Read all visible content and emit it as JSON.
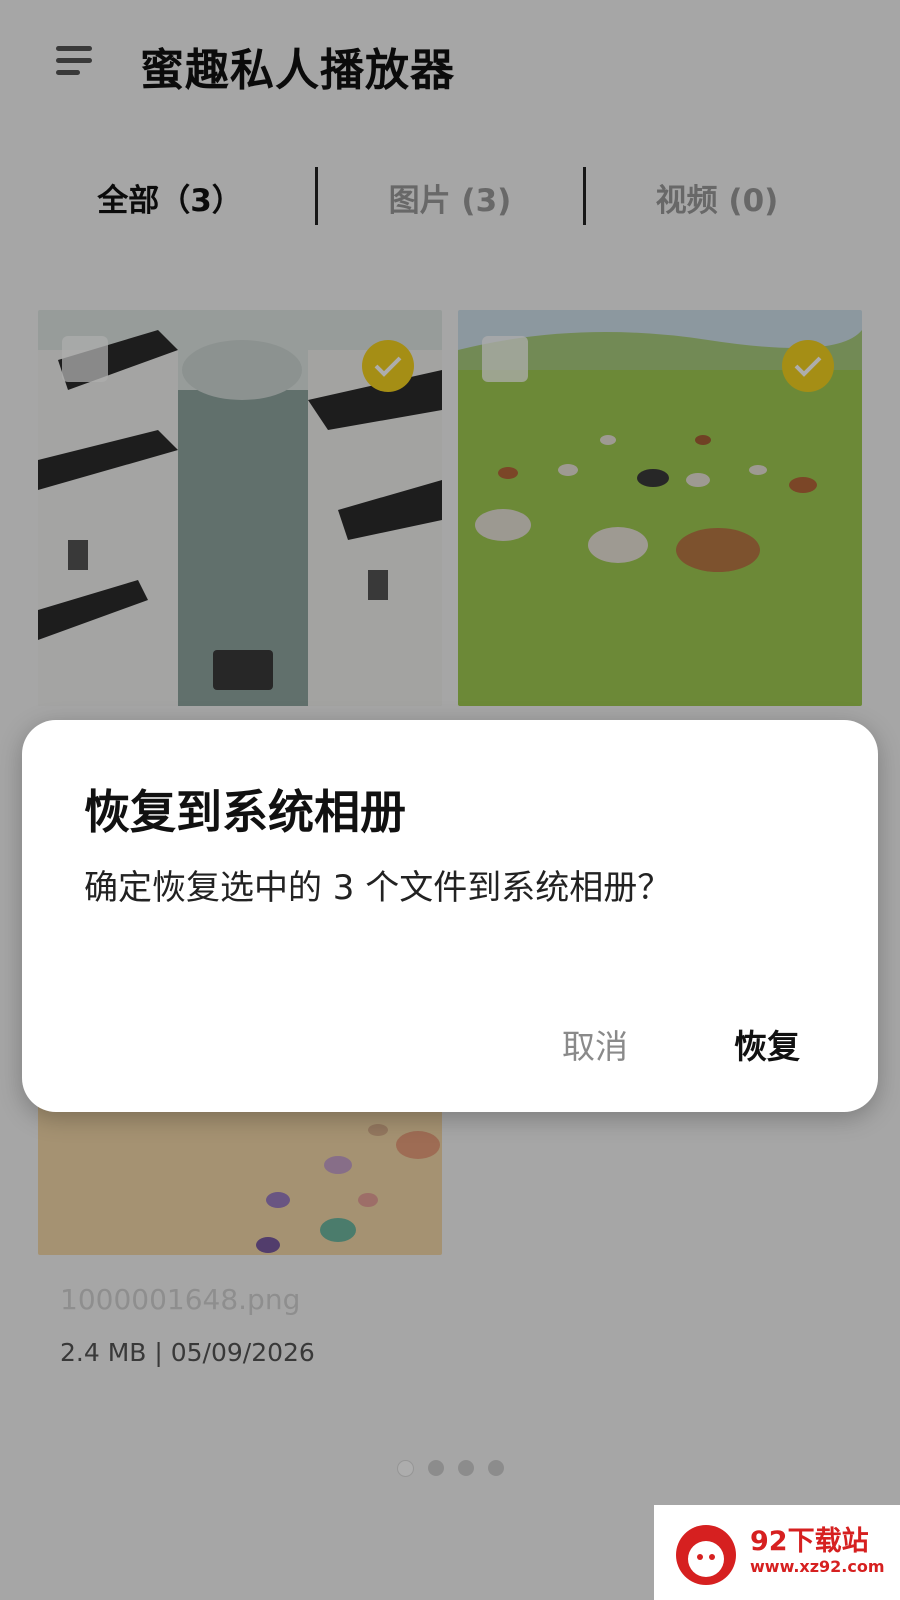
{
  "app": {
    "title": "蜜趣私人播放器"
  },
  "tabs": [
    {
      "label": "全部（3）",
      "active": true
    },
    {
      "label": "图片 (3)",
      "active": false
    },
    {
      "label": "视频 (0)",
      "active": false
    }
  ],
  "grid": {
    "items": [
      {
        "selected": true,
        "icon": "check-icon"
      },
      {
        "selected": true,
        "icon": "check-icon"
      },
      {
        "selected": false
      }
    ],
    "visible_file": {
      "name": "1000001648.png",
      "meta": "2.4 MB  |  05/09/2026"
    }
  },
  "pager": {
    "count": 4,
    "active_index": 0
  },
  "dialog": {
    "title": "恢复到系统相册",
    "message": "确定恢复选中的 3 个文件到系统相册？",
    "cancel_label": "取消",
    "confirm_label": "恢复"
  },
  "watermark": {
    "text": "92下载站",
    "url": "www.xz92.com"
  },
  "colors": {
    "check": "#f4d120",
    "dialog_bg": "#ffffff",
    "watermark_red": "#d62020"
  }
}
